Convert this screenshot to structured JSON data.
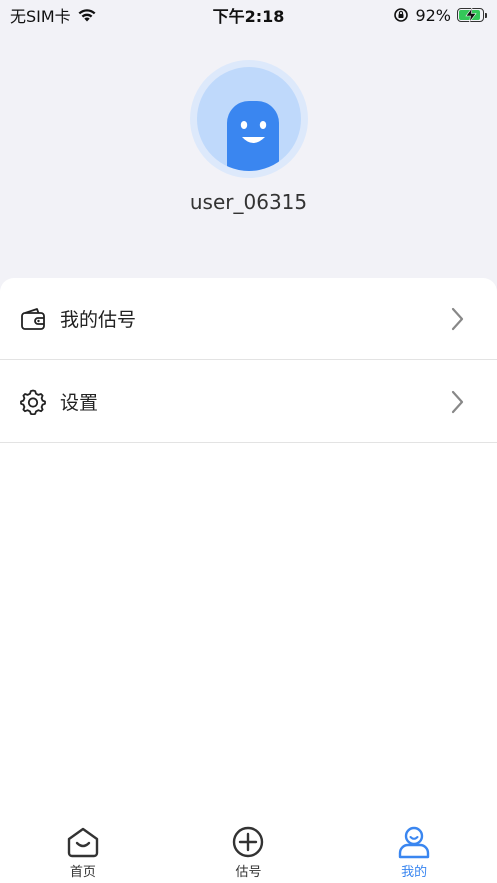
{
  "status_bar": {
    "carrier": "无SIM卡",
    "time": "下午2:18",
    "battery_percent": "92%",
    "battery_level": 0.92
  },
  "profile": {
    "username": "user_06315"
  },
  "menu": {
    "items": [
      {
        "label": "我的估号",
        "icon": "wallet-icon"
      },
      {
        "label": "设置",
        "icon": "gear-icon"
      }
    ]
  },
  "tab_bar": {
    "tabs": [
      {
        "label": "首页",
        "icon": "home-icon",
        "active": false
      },
      {
        "label": "估号",
        "icon": "plus-circle-icon",
        "active": false
      },
      {
        "label": "我的",
        "icon": "user-icon",
        "active": true
      }
    ]
  },
  "colors": {
    "accent": "#3a86f0",
    "avatar_bg": "#bfd9fb",
    "page_bg": "#f2f2f7",
    "battery_green": "#34c759"
  }
}
